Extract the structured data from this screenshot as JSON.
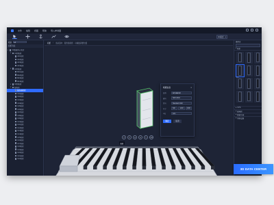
{
  "menubar": {
    "items": [
      "文件",
      "编辑",
      "视图",
      "帮助",
      "导入参考图"
    ]
  },
  "toolbar": {
    "tools": [
      "pointer-icon",
      "move-icon",
      "anchor-icon",
      "measure-icon",
      "eye-icon"
    ],
    "dropdown_value": "3D模式"
  },
  "left_panel": {
    "selector_label": "机房",
    "selector_value": "1#",
    "section_title": "机柜列表",
    "tree": [
      {
        "label": "XX数据中心机房",
        "level": 0
      },
      {
        "label": "01列机柜",
        "level": 1
      },
      {
        "label": "A01机柜",
        "level": 2
      },
      {
        "label": "A02机柜",
        "level": 2
      },
      {
        "label": "A03机柜",
        "level": 2
      },
      {
        "label": "A04机柜",
        "level": 2
      },
      {
        "label": "02列机柜",
        "level": 1
      },
      {
        "label": "B01机柜",
        "level": 2
      },
      {
        "label": "B02机柜",
        "level": 2
      },
      {
        "label": "B03机柜",
        "level": 2
      },
      {
        "label": "B04机柜",
        "level": 2
      },
      {
        "label": "03列机柜",
        "level": 1
      },
      {
        "label": "配电柜",
        "level": 1
      },
      {
        "label": "服务器机柜",
        "level": 2
      },
      {
        "label": "C01机柜",
        "level": 2
      },
      {
        "label": "C02机柜",
        "level": 2
      },
      {
        "label": "C03机柜",
        "level": 2
      },
      {
        "label": "C04机柜",
        "level": 2
      },
      {
        "label": "C05机柜",
        "level": 2
      },
      {
        "label": "C06机柜",
        "level": 2
      },
      {
        "label": "C07机柜",
        "level": 2
      },
      {
        "label": "C08机柜",
        "level": 2
      },
      {
        "label": "C09机柜",
        "level": 2
      },
      {
        "label": "C10机柜",
        "level": 2
      },
      {
        "label": "C11机柜",
        "level": 2
      },
      {
        "label": "C12机柜",
        "level": 2
      },
      {
        "label": "C13机柜",
        "level": 2
      },
      {
        "label": "C14机柜",
        "level": 2
      },
      {
        "label": "C15机柜",
        "level": 2
      },
      {
        "label": "C16机柜",
        "level": 2
      },
      {
        "label": "C17机柜",
        "level": 2
      },
      {
        "label": "C18机柜",
        "level": 2
      },
      {
        "label": "C19机柜",
        "level": 2
      },
      {
        "label": "C20机柜",
        "level": 2
      },
      {
        "label": "C21机柜",
        "level": 2
      },
      {
        "label": "C22机柜",
        "level": 2
      }
    ],
    "selected_index": 13
  },
  "center": {
    "tab_label": "机柜",
    "breadcrumb": "当前选中：服务器机柜 · 可拖拽调整位置"
  },
  "dialog": {
    "title": "机柜信息",
    "fields": [
      {
        "label": "名称",
        "value": "服务器机柜"
      },
      {
        "label": "编号",
        "value": "SRV-0010"
      },
      {
        "label": "型号",
        "value": "Standard 42U"
      }
    ],
    "size_label": "尺寸",
    "sizes": [
      "600",
      "1200",
      "2000"
    ],
    "extra_label": "U位",
    "extra_value": "42U",
    "confirm_label": "确定",
    "cancel_label": "取消"
  },
  "floating_tools": [
    "↺",
    "↻",
    "⊕",
    "⊖",
    "✎",
    "⌫"
  ],
  "tooltip": "旋转",
  "right_panel": {
    "title": "模型库",
    "group": "机柜",
    "thumb_caption": "机柜",
    "categories": [
      "UPS",
      "配电柜",
      "精密空调",
      "消防设备"
    ]
  },
  "badge": {
    "text": "3D DATA CENTER"
  },
  "colors": {
    "accent": "#2f6bff",
    "window_bg": "#1b2133",
    "page_bg": "#edeef1"
  }
}
